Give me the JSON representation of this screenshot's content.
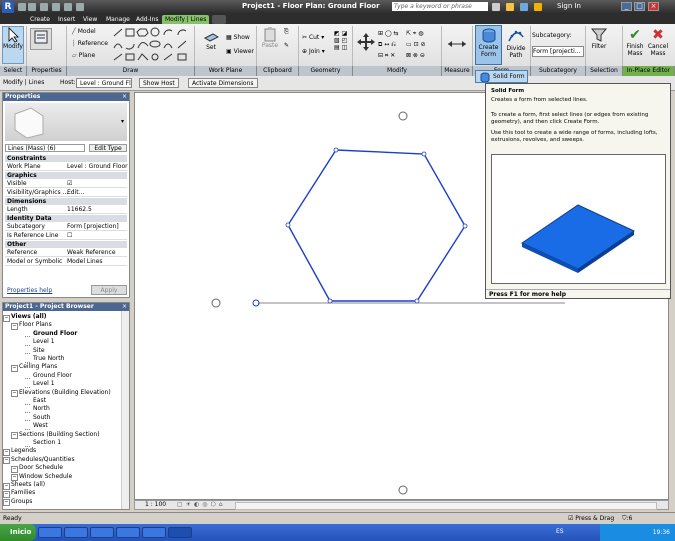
{
  "window": {
    "title": "Project1 - Floor Plan: Ground Floor",
    "search_placeholder": "Type a keyword or phrase",
    "sign_in": "Sign In"
  },
  "tabs": [
    "Create",
    "Insert",
    "View",
    "Manage",
    "Add-Ins",
    "Modify | Lines"
  ],
  "ribbon": {
    "modify": "Modify",
    "draw_items": [
      "Model",
      "Reference",
      "Plane"
    ],
    "workplane": {
      "set": "Set",
      "show": "Show",
      "viewer": "Viewer"
    },
    "clipboard": {
      "paste": "Paste",
      "cut": "Cut",
      "join": "Join"
    },
    "form": {
      "create_form": "Create Form",
      "divide_path": "Divide Path"
    },
    "subcategory": {
      "label": "Subcategory:",
      "value": "Form [projecti..."
    },
    "filter": "Filter",
    "finish": "Finish Mass",
    "cancel": "Cancel Mass",
    "panels": [
      "Select",
      "Properties",
      "Draw",
      "Work Plane",
      "Clipboard",
      "Geometry",
      "Modify",
      "Measure",
      "Form",
      "Subcategory",
      "Selection",
      "In-Place Editor"
    ]
  },
  "options_bar": {
    "context": "Modify | Lines",
    "host_label": "Host:",
    "host_value": "Level : Ground Fl",
    "show_host": "Show Host",
    "activate_dimensions": "Activate Dimensions"
  },
  "properties": {
    "title": "Properties",
    "type_selector": "Lines (Mass) (6)",
    "edit_type": "Edit Type",
    "groups": [
      {
        "name": "Constraints",
        "rows": [
          [
            "Work Plane",
            "Level : Ground Floor"
          ]
        ]
      },
      {
        "name": "Graphics",
        "rows": [
          [
            "Visible",
            "☑"
          ],
          [
            "Visibility/Graphics ...",
            "Edit..."
          ]
        ]
      },
      {
        "name": "Dimensions",
        "rows": [
          [
            "Length",
            "11662.5"
          ]
        ]
      },
      {
        "name": "Identity Data",
        "rows": [
          [
            "Subcategory",
            "Form [projection]"
          ],
          [
            "Is Reference Line",
            "☐"
          ]
        ]
      },
      {
        "name": "Other",
        "rows": [
          [
            "Reference",
            "Weak Reference"
          ],
          [
            "Model or Symbolic",
            "Model Lines"
          ]
        ]
      }
    ],
    "help": "Properties help",
    "apply": "Apply"
  },
  "project_browser": {
    "title": "Project1 - Project Browser",
    "items": [
      {
        "label": "Views (all)",
        "level": 0,
        "bold": true
      },
      {
        "label": "Floor Plans",
        "level": 1
      },
      {
        "label": "Ground Floor",
        "level": 2,
        "bold": true
      },
      {
        "label": "Level 1",
        "level": 2
      },
      {
        "label": "Site",
        "level": 2
      },
      {
        "label": "True North",
        "level": 2
      },
      {
        "label": "Ceiling Plans",
        "level": 1
      },
      {
        "label": "Ground Floor",
        "level": 2
      },
      {
        "label": "Level 1",
        "level": 2
      },
      {
        "label": "Elevations (Building Elevation)",
        "level": 1
      },
      {
        "label": "East",
        "level": 2
      },
      {
        "label": "North",
        "level": 2
      },
      {
        "label": "South",
        "level": 2
      },
      {
        "label": "West",
        "level": 2
      },
      {
        "label": "Sections (Building Section)",
        "level": 1
      },
      {
        "label": "Section 1",
        "level": 2
      },
      {
        "label": "Legends",
        "level": 0
      },
      {
        "label": "Schedules/Quantities",
        "level": 0
      },
      {
        "label": "Door Schedule",
        "level": 1
      },
      {
        "label": "Window Schedule",
        "level": 1
      },
      {
        "label": "Sheets (all)",
        "level": 0
      },
      {
        "label": "Families",
        "level": 0
      },
      {
        "label": "Groups",
        "level": 0
      }
    ]
  },
  "tooltip": {
    "button": "Solid Form",
    "title": "Solid Form",
    "line1": "Creates a form from selected lines.",
    "line2": "To create a form, first select lines (or edges from existing geometry), and then click Create Form.",
    "line3": "Use this tool to create a wide range of forms, including lofts, extrusions, revolves, and sweeps.",
    "footer": "Press F1 for more help"
  },
  "view_bar": {
    "scale": "1 : 100"
  },
  "status": {
    "text": "Ready",
    "press_drag": "Press & Drag",
    "filter_count": ":6"
  },
  "taskbar": {
    "start": "Inicio",
    "lang": "ES",
    "time": "19:36"
  },
  "colors": {
    "accent_green": "#72b04e",
    "selection_blue": "#1c3fc9",
    "form_fill": "#1a6be6"
  }
}
